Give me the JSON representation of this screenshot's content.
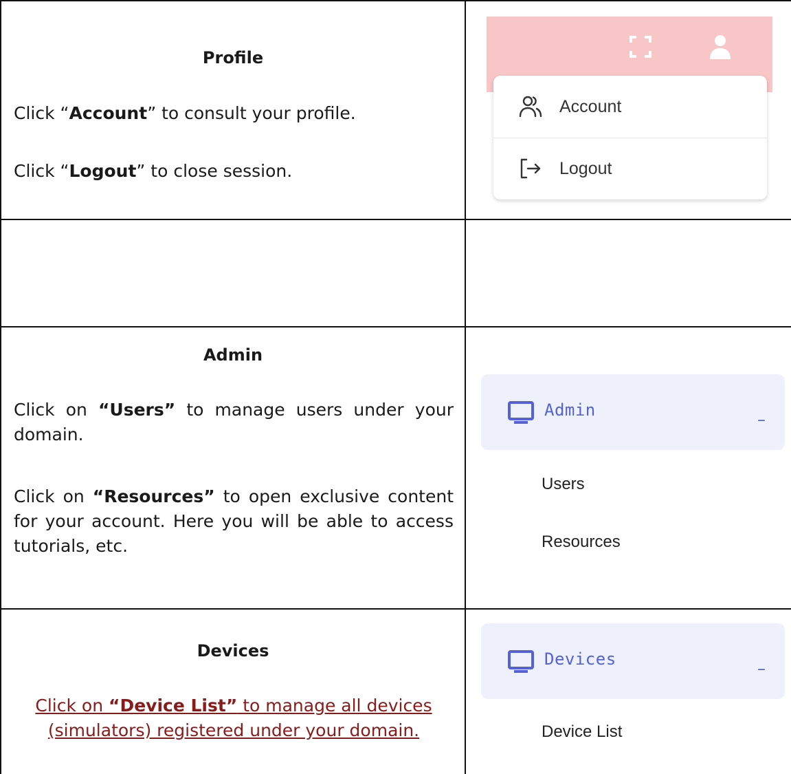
{
  "profile": {
    "heading": "Profile",
    "line1_pre": "Click “",
    "line1_bold": "Account",
    "line1_post": "” to consult your profile.",
    "line2_pre": "Click “",
    "line2_bold": "Logout",
    "line2_post": "” to close session.",
    "menu_items": [
      {
        "label": "Account",
        "icon": "users-icon"
      },
      {
        "label": "Logout",
        "icon": "logout-icon"
      }
    ],
    "topbar_icons": [
      "fullscreen-icon",
      "user-icon"
    ],
    "topbar_color": "#f8c6c6"
  },
  "admin": {
    "heading": "Admin",
    "p1_pre": "Click on ",
    "p1_bold": "“Users”",
    "p1_post": " to manage users under your domain.",
    "p2_pre": "Click on ",
    "p2_bold": "“Resources”",
    "p2_post": " to open exclusive content for your account. Here you will be able  to  access tutorials, etc.",
    "menu_title": "Admin",
    "collapse_symbol": "–",
    "sub_items": [
      "Users",
      "Resources"
    ],
    "accent": "#5561d6"
  },
  "devices": {
    "heading": "Devices",
    "link_pre": "Click on ",
    "link_bold": "“Device List”",
    "link_post": " to manage all devices (simulators) registered under your domain.",
    "menu_title": "Devices",
    "collapse_symbol": "–",
    "sub_items": [
      "Device List"
    ],
    "link_color": "#8b1a1a"
  }
}
